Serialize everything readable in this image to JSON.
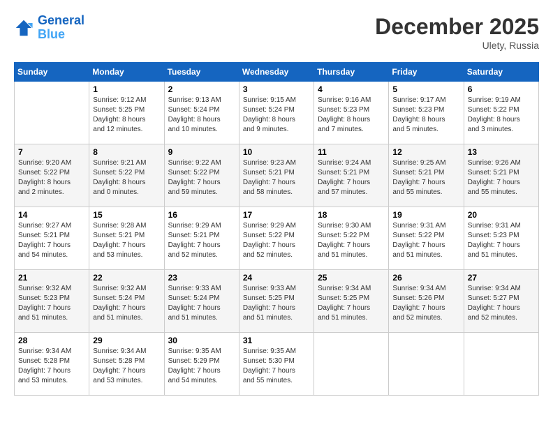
{
  "header": {
    "logo_line1": "General",
    "logo_line2": "Blue",
    "month_year": "December 2025",
    "location": "Ulety, Russia"
  },
  "days_of_week": [
    "Sunday",
    "Monday",
    "Tuesday",
    "Wednesday",
    "Thursday",
    "Friday",
    "Saturday"
  ],
  "weeks": [
    [
      {
        "day": "",
        "info": ""
      },
      {
        "day": "1",
        "info": "Sunrise: 9:12 AM\nSunset: 5:25 PM\nDaylight: 8 hours\nand 12 minutes."
      },
      {
        "day": "2",
        "info": "Sunrise: 9:13 AM\nSunset: 5:24 PM\nDaylight: 8 hours\nand 10 minutes."
      },
      {
        "day": "3",
        "info": "Sunrise: 9:15 AM\nSunset: 5:24 PM\nDaylight: 8 hours\nand 9 minutes."
      },
      {
        "day": "4",
        "info": "Sunrise: 9:16 AM\nSunset: 5:23 PM\nDaylight: 8 hours\nand 7 minutes."
      },
      {
        "day": "5",
        "info": "Sunrise: 9:17 AM\nSunset: 5:23 PM\nDaylight: 8 hours\nand 5 minutes."
      },
      {
        "day": "6",
        "info": "Sunrise: 9:19 AM\nSunset: 5:22 PM\nDaylight: 8 hours\nand 3 minutes."
      }
    ],
    [
      {
        "day": "7",
        "info": "Sunrise: 9:20 AM\nSunset: 5:22 PM\nDaylight: 8 hours\nand 2 minutes."
      },
      {
        "day": "8",
        "info": "Sunrise: 9:21 AM\nSunset: 5:22 PM\nDaylight: 8 hours\nand 0 minutes."
      },
      {
        "day": "9",
        "info": "Sunrise: 9:22 AM\nSunset: 5:22 PM\nDaylight: 7 hours\nand 59 minutes."
      },
      {
        "day": "10",
        "info": "Sunrise: 9:23 AM\nSunset: 5:21 PM\nDaylight: 7 hours\nand 58 minutes."
      },
      {
        "day": "11",
        "info": "Sunrise: 9:24 AM\nSunset: 5:21 PM\nDaylight: 7 hours\nand 57 minutes."
      },
      {
        "day": "12",
        "info": "Sunrise: 9:25 AM\nSunset: 5:21 PM\nDaylight: 7 hours\nand 55 minutes."
      },
      {
        "day": "13",
        "info": "Sunrise: 9:26 AM\nSunset: 5:21 PM\nDaylight: 7 hours\nand 55 minutes."
      }
    ],
    [
      {
        "day": "14",
        "info": "Sunrise: 9:27 AM\nSunset: 5:21 PM\nDaylight: 7 hours\nand 54 minutes."
      },
      {
        "day": "15",
        "info": "Sunrise: 9:28 AM\nSunset: 5:21 PM\nDaylight: 7 hours\nand 53 minutes."
      },
      {
        "day": "16",
        "info": "Sunrise: 9:29 AM\nSunset: 5:21 PM\nDaylight: 7 hours\nand 52 minutes."
      },
      {
        "day": "17",
        "info": "Sunrise: 9:29 AM\nSunset: 5:22 PM\nDaylight: 7 hours\nand 52 minutes."
      },
      {
        "day": "18",
        "info": "Sunrise: 9:30 AM\nSunset: 5:22 PM\nDaylight: 7 hours\nand 51 minutes."
      },
      {
        "day": "19",
        "info": "Sunrise: 9:31 AM\nSunset: 5:22 PM\nDaylight: 7 hours\nand 51 minutes."
      },
      {
        "day": "20",
        "info": "Sunrise: 9:31 AM\nSunset: 5:23 PM\nDaylight: 7 hours\nand 51 minutes."
      }
    ],
    [
      {
        "day": "21",
        "info": "Sunrise: 9:32 AM\nSunset: 5:23 PM\nDaylight: 7 hours\nand 51 minutes."
      },
      {
        "day": "22",
        "info": "Sunrise: 9:32 AM\nSunset: 5:24 PM\nDaylight: 7 hours\nand 51 minutes."
      },
      {
        "day": "23",
        "info": "Sunrise: 9:33 AM\nSunset: 5:24 PM\nDaylight: 7 hours\nand 51 minutes."
      },
      {
        "day": "24",
        "info": "Sunrise: 9:33 AM\nSunset: 5:25 PM\nDaylight: 7 hours\nand 51 minutes."
      },
      {
        "day": "25",
        "info": "Sunrise: 9:34 AM\nSunset: 5:25 PM\nDaylight: 7 hours\nand 51 minutes."
      },
      {
        "day": "26",
        "info": "Sunrise: 9:34 AM\nSunset: 5:26 PM\nDaylight: 7 hours\nand 52 minutes."
      },
      {
        "day": "27",
        "info": "Sunrise: 9:34 AM\nSunset: 5:27 PM\nDaylight: 7 hours\nand 52 minutes."
      }
    ],
    [
      {
        "day": "28",
        "info": "Sunrise: 9:34 AM\nSunset: 5:28 PM\nDaylight: 7 hours\nand 53 minutes."
      },
      {
        "day": "29",
        "info": "Sunrise: 9:34 AM\nSunset: 5:28 PM\nDaylight: 7 hours\nand 53 minutes."
      },
      {
        "day": "30",
        "info": "Sunrise: 9:35 AM\nSunset: 5:29 PM\nDaylight: 7 hours\nand 54 minutes."
      },
      {
        "day": "31",
        "info": "Sunrise: 9:35 AM\nSunset: 5:30 PM\nDaylight: 7 hours\nand 55 minutes."
      },
      {
        "day": "",
        "info": ""
      },
      {
        "day": "",
        "info": ""
      },
      {
        "day": "",
        "info": ""
      }
    ]
  ]
}
